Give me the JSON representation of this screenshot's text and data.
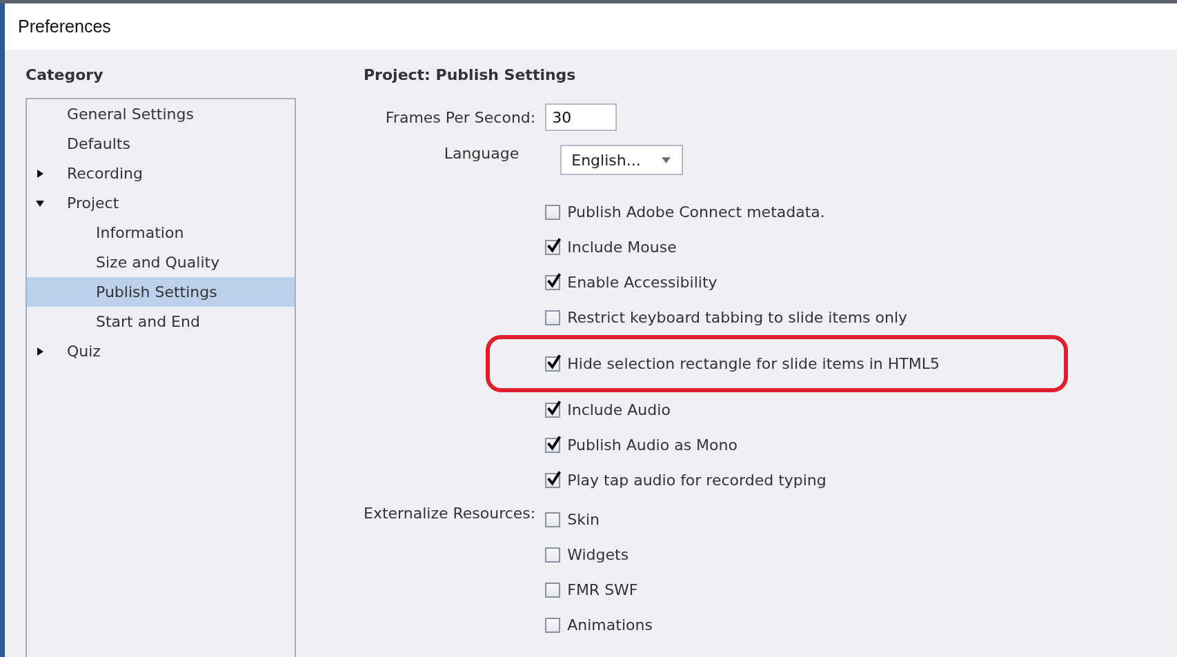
{
  "window": {
    "title": "Preferences"
  },
  "category": {
    "title": "Category",
    "items": [
      {
        "label": "General Settings",
        "selected": false
      },
      {
        "label": "Defaults",
        "selected": false
      },
      {
        "label": "Recording",
        "selected": false,
        "expanded": false
      },
      {
        "label": "Project",
        "selected": false,
        "expanded": true,
        "children": [
          {
            "label": "Information",
            "selected": false
          },
          {
            "label": "Size and Quality",
            "selected": false
          },
          {
            "label": "Publish Settings",
            "selected": true
          },
          {
            "label": "Start and End",
            "selected": false
          }
        ]
      },
      {
        "label": "Quiz",
        "selected": false,
        "expanded": false
      }
    ]
  },
  "settings": {
    "heading": "Project: Publish Settings",
    "frames_per_second": {
      "label": "Frames Per Second:",
      "value": "30"
    },
    "language": {
      "label": "Language",
      "value": "English..."
    },
    "options": [
      {
        "label": "Publish Adobe Connect metadata.",
        "checked": false,
        "highlighted": false
      },
      {
        "label": "Include Mouse",
        "checked": true,
        "highlighted": false
      },
      {
        "label": "Enable Accessibility",
        "checked": true,
        "highlighted": false
      },
      {
        "label": "Restrict keyboard tabbing to slide items only",
        "checked": false,
        "highlighted": false
      },
      {
        "label": "Hide selection rectangle for slide items in HTML5",
        "checked": true,
        "highlighted": true
      },
      {
        "label": "Include Audio",
        "checked": true,
        "highlighted": false
      },
      {
        "label": "Publish Audio as Mono",
        "checked": true,
        "highlighted": false
      },
      {
        "label": "Play tap audio for recorded typing",
        "checked": true,
        "highlighted": false
      }
    ],
    "externalize": {
      "label": "Externalize Resources:",
      "options": [
        {
          "label": "Skin",
          "checked": false
        },
        {
          "label": "Widgets",
          "checked": false
        },
        {
          "label": "FMR SWF",
          "checked": false
        },
        {
          "label": "Animations",
          "checked": false
        }
      ]
    }
  }
}
